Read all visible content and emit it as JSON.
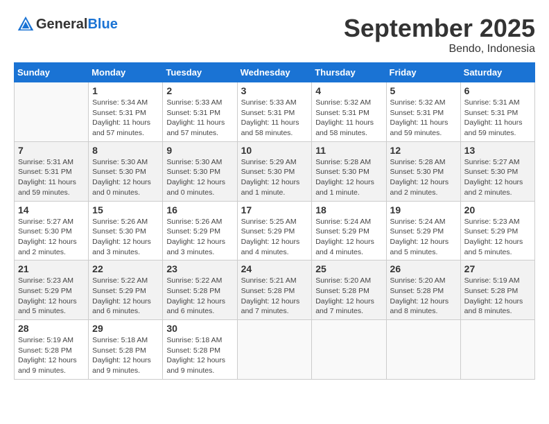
{
  "logo": {
    "general": "General",
    "blue": "Blue"
  },
  "title": "September 2025",
  "location": "Bendo, Indonesia",
  "days_of_week": [
    "Sunday",
    "Monday",
    "Tuesday",
    "Wednesday",
    "Thursday",
    "Friday",
    "Saturday"
  ],
  "weeks": [
    [
      {
        "day": "",
        "sunrise": "",
        "sunset": "",
        "daylight": ""
      },
      {
        "day": "1",
        "sunrise": "Sunrise: 5:34 AM",
        "sunset": "Sunset: 5:31 PM",
        "daylight": "Daylight: 11 hours and 57 minutes."
      },
      {
        "day": "2",
        "sunrise": "Sunrise: 5:33 AM",
        "sunset": "Sunset: 5:31 PM",
        "daylight": "Daylight: 11 hours and 57 minutes."
      },
      {
        "day": "3",
        "sunrise": "Sunrise: 5:33 AM",
        "sunset": "Sunset: 5:31 PM",
        "daylight": "Daylight: 11 hours and 58 minutes."
      },
      {
        "day": "4",
        "sunrise": "Sunrise: 5:32 AM",
        "sunset": "Sunset: 5:31 PM",
        "daylight": "Daylight: 11 hours and 58 minutes."
      },
      {
        "day": "5",
        "sunrise": "Sunrise: 5:32 AM",
        "sunset": "Sunset: 5:31 PM",
        "daylight": "Daylight: 11 hours and 59 minutes."
      },
      {
        "day": "6",
        "sunrise": "Sunrise: 5:31 AM",
        "sunset": "Sunset: 5:31 PM",
        "daylight": "Daylight: 11 hours and 59 minutes."
      }
    ],
    [
      {
        "day": "7",
        "sunrise": "Sunrise: 5:31 AM",
        "sunset": "Sunset: 5:31 PM",
        "daylight": "Daylight: 11 hours and 59 minutes."
      },
      {
        "day": "8",
        "sunrise": "Sunrise: 5:30 AM",
        "sunset": "Sunset: 5:30 PM",
        "daylight": "Daylight: 12 hours and 0 minutes."
      },
      {
        "day": "9",
        "sunrise": "Sunrise: 5:30 AM",
        "sunset": "Sunset: 5:30 PM",
        "daylight": "Daylight: 12 hours and 0 minutes."
      },
      {
        "day": "10",
        "sunrise": "Sunrise: 5:29 AM",
        "sunset": "Sunset: 5:30 PM",
        "daylight": "Daylight: 12 hours and 1 minute."
      },
      {
        "day": "11",
        "sunrise": "Sunrise: 5:28 AM",
        "sunset": "Sunset: 5:30 PM",
        "daylight": "Daylight: 12 hours and 1 minute."
      },
      {
        "day": "12",
        "sunrise": "Sunrise: 5:28 AM",
        "sunset": "Sunset: 5:30 PM",
        "daylight": "Daylight: 12 hours and 2 minutes."
      },
      {
        "day": "13",
        "sunrise": "Sunrise: 5:27 AM",
        "sunset": "Sunset: 5:30 PM",
        "daylight": "Daylight: 12 hours and 2 minutes."
      }
    ],
    [
      {
        "day": "14",
        "sunrise": "Sunrise: 5:27 AM",
        "sunset": "Sunset: 5:30 PM",
        "daylight": "Daylight: 12 hours and 2 minutes."
      },
      {
        "day": "15",
        "sunrise": "Sunrise: 5:26 AM",
        "sunset": "Sunset: 5:30 PM",
        "daylight": "Daylight: 12 hours and 3 minutes."
      },
      {
        "day": "16",
        "sunrise": "Sunrise: 5:26 AM",
        "sunset": "Sunset: 5:29 PM",
        "daylight": "Daylight: 12 hours and 3 minutes."
      },
      {
        "day": "17",
        "sunrise": "Sunrise: 5:25 AM",
        "sunset": "Sunset: 5:29 PM",
        "daylight": "Daylight: 12 hours and 4 minutes."
      },
      {
        "day": "18",
        "sunrise": "Sunrise: 5:24 AM",
        "sunset": "Sunset: 5:29 PM",
        "daylight": "Daylight: 12 hours and 4 minutes."
      },
      {
        "day": "19",
        "sunrise": "Sunrise: 5:24 AM",
        "sunset": "Sunset: 5:29 PM",
        "daylight": "Daylight: 12 hours and 5 minutes."
      },
      {
        "day": "20",
        "sunrise": "Sunrise: 5:23 AM",
        "sunset": "Sunset: 5:29 PM",
        "daylight": "Daylight: 12 hours and 5 minutes."
      }
    ],
    [
      {
        "day": "21",
        "sunrise": "Sunrise: 5:23 AM",
        "sunset": "Sunset: 5:29 PM",
        "daylight": "Daylight: 12 hours and 5 minutes."
      },
      {
        "day": "22",
        "sunrise": "Sunrise: 5:22 AM",
        "sunset": "Sunset: 5:29 PM",
        "daylight": "Daylight: 12 hours and 6 minutes."
      },
      {
        "day": "23",
        "sunrise": "Sunrise: 5:22 AM",
        "sunset": "Sunset: 5:28 PM",
        "daylight": "Daylight: 12 hours and 6 minutes."
      },
      {
        "day": "24",
        "sunrise": "Sunrise: 5:21 AM",
        "sunset": "Sunset: 5:28 PM",
        "daylight": "Daylight: 12 hours and 7 minutes."
      },
      {
        "day": "25",
        "sunrise": "Sunrise: 5:20 AM",
        "sunset": "Sunset: 5:28 PM",
        "daylight": "Daylight: 12 hours and 7 minutes."
      },
      {
        "day": "26",
        "sunrise": "Sunrise: 5:20 AM",
        "sunset": "Sunset: 5:28 PM",
        "daylight": "Daylight: 12 hours and 8 minutes."
      },
      {
        "day": "27",
        "sunrise": "Sunrise: 5:19 AM",
        "sunset": "Sunset: 5:28 PM",
        "daylight": "Daylight: 12 hours and 8 minutes."
      }
    ],
    [
      {
        "day": "28",
        "sunrise": "Sunrise: 5:19 AM",
        "sunset": "Sunset: 5:28 PM",
        "daylight": "Daylight: 12 hours and 9 minutes."
      },
      {
        "day": "29",
        "sunrise": "Sunrise: 5:18 AM",
        "sunset": "Sunset: 5:28 PM",
        "daylight": "Daylight: 12 hours and 9 minutes."
      },
      {
        "day": "30",
        "sunrise": "Sunrise: 5:18 AM",
        "sunset": "Sunset: 5:28 PM",
        "daylight": "Daylight: 12 hours and 9 minutes."
      },
      {
        "day": "",
        "sunrise": "",
        "sunset": "",
        "daylight": ""
      },
      {
        "day": "",
        "sunrise": "",
        "sunset": "",
        "daylight": ""
      },
      {
        "day": "",
        "sunrise": "",
        "sunset": "",
        "daylight": ""
      },
      {
        "day": "",
        "sunrise": "",
        "sunset": "",
        "daylight": ""
      }
    ]
  ]
}
